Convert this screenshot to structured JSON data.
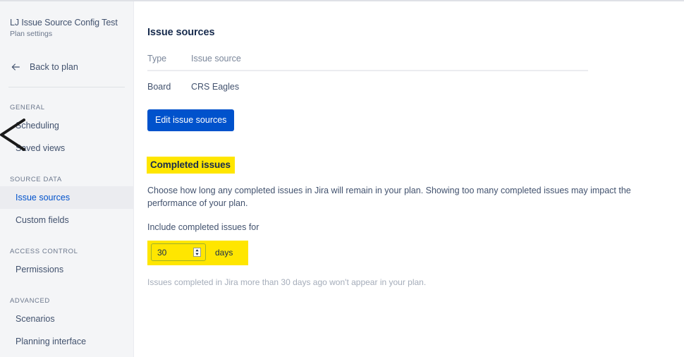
{
  "sidebar": {
    "plan_title": "LJ Issue Source Config Test",
    "plan_subtitle": "Plan settings",
    "back_label": "Back to plan",
    "back_icon": "arrow-left-icon",
    "groups": [
      {
        "label": "GENERAL",
        "items": [
          {
            "label": "Scheduling",
            "selected": false
          },
          {
            "label": "Saved views",
            "selected": false
          }
        ]
      },
      {
        "label": "SOURCE DATA",
        "items": [
          {
            "label": "Issue sources",
            "selected": true
          },
          {
            "label": "Custom fields",
            "selected": false
          }
        ]
      },
      {
        "label": "ACCESS CONTROL",
        "items": [
          {
            "label": "Permissions",
            "selected": false
          }
        ]
      },
      {
        "label": "ADVANCED",
        "items": [
          {
            "label": "Scenarios",
            "selected": false
          },
          {
            "label": "Planning interface",
            "selected": false
          }
        ]
      }
    ]
  },
  "main": {
    "issue_sources": {
      "heading": "Issue sources",
      "columns": [
        "Type",
        "Issue source"
      ],
      "rows": [
        {
          "type": "Board",
          "source": "CRS Eagles"
        }
      ],
      "edit_button": "Edit issue sources"
    },
    "completed_issues": {
      "heading": "Completed issues",
      "description": "Choose how long any completed issues in Jira will remain in your plan. Showing too many completed issues may impact the performance of your plan.",
      "field_label": "Include completed issues for",
      "days_value": "30",
      "days_unit": "days",
      "stepper_icon": "spinner-up-down-icon",
      "note": "Issues completed in Jira more than 30 days ago won't appear in your plan."
    }
  },
  "annotations": {
    "chevron_marker": "hand-drawn-chevron-marker",
    "highlight_color": "#FFE600"
  },
  "colors": {
    "accent": "#0052CC",
    "sidebar_bg": "#F4F5F7",
    "selected_bg": "#EBECF0",
    "highlight": "#FFE600",
    "text": "#42526E",
    "muted": "#6B778C"
  }
}
